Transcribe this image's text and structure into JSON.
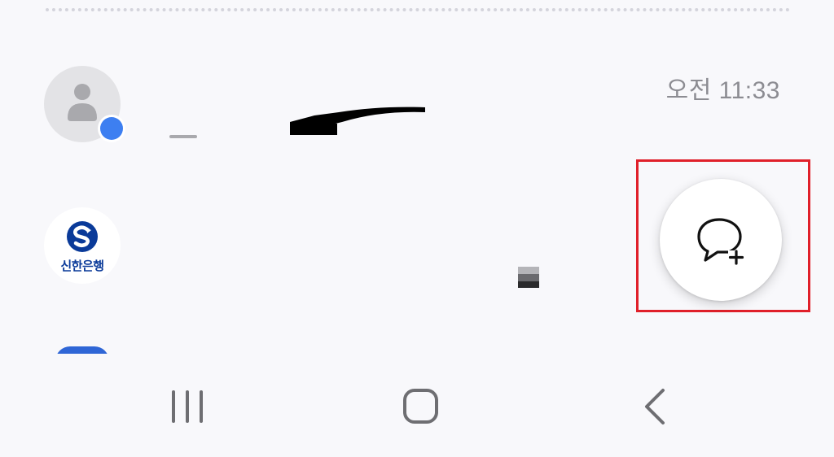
{
  "conversations": [
    {
      "avatar": "person-silhouette-icon",
      "badge": "rcs-chat-badge",
      "time": "오전 11:33",
      "name": "",
      "preview": ""
    },
    {
      "avatar": "shinhan-bank-logo",
      "avatar_text": "신한은행",
      "time": "",
      "name": "",
      "preview": ""
    }
  ],
  "fab": {
    "icon": "chat-bubble-plus-icon"
  },
  "nav": {
    "recent": "recent-apps-icon",
    "home": "home-icon",
    "back": "back-icon"
  },
  "colors": {
    "background": "#f8f8fb",
    "accent_blue": "#3d7ff1",
    "bank_blue": "#0a3a99",
    "highlight_red": "#e0202a",
    "timestamp_gray": "#8c8c92"
  }
}
